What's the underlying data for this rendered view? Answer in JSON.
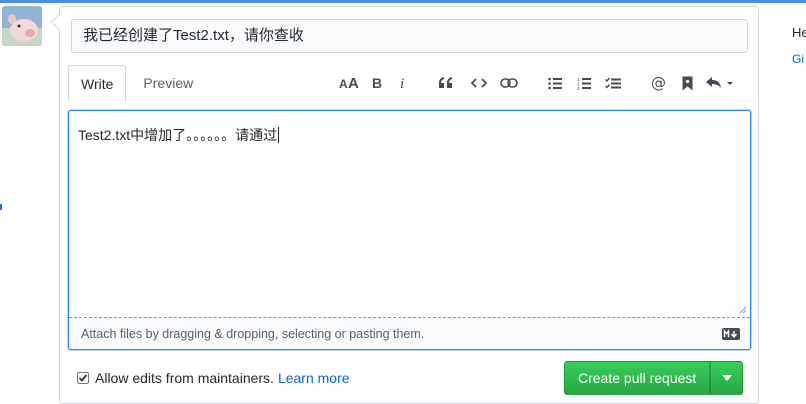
{
  "pr_form": {
    "title_value": "我已经创建了Test2.txt，请你查收",
    "tabs": [
      {
        "label": "Write",
        "active": true
      },
      {
        "label": "Preview",
        "active": false
      }
    ],
    "toolbar_icons": [
      "header-icon",
      "bold-icon",
      "italic-icon",
      "quote-icon",
      "code-icon",
      "link-icon",
      "bulleted-list-icon",
      "numbered-list-icon",
      "task-list-icon",
      "mention-icon",
      "saved-reply-icon",
      "reply-icon"
    ],
    "body_value": "Test2.txt中增加了。。。。。。请通过",
    "attach_hint": "Attach files by dragging & dropping, selecting or pasting them.",
    "markdown_badge": "M↓",
    "allow_edits_label": "Allow edits from maintainers.",
    "allow_edits_checked": true,
    "learn_more": "Learn more",
    "create_button": "Create pull request"
  },
  "sidebar_cut": {
    "heading_fragment": "He",
    "link_fragment": "Gi"
  },
  "colors": {
    "accent": "#2188ff",
    "primary_button": "#28a745",
    "link": "#0366d6"
  }
}
